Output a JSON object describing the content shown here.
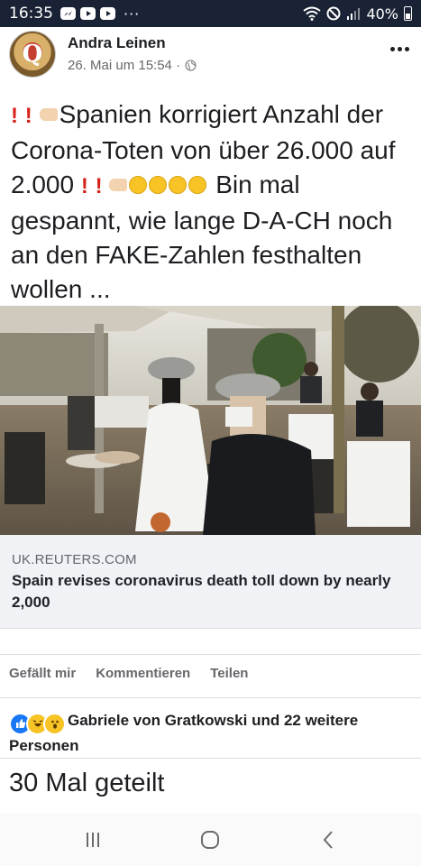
{
  "status_bar": {
    "time": "16:35",
    "dots": "···",
    "battery": "40%",
    "icons": [
      "messenger-icon",
      "youtube-icon",
      "youtube-icon",
      "wifi-icon",
      "do-not-disturb-icon",
      "signal-icon",
      "battery-icon"
    ]
  },
  "post": {
    "author": "Andra Leinen",
    "date": "26. Mai um 15:54 ·",
    "text_line1": "Spanien korrigiert Anzahl der Corona-Toten von über 26.000 auf 2.000",
    "text_line2": "Bin mal gespannt, wie lange D-A-CH noch an den FAKE-Zahlen festhalten wollen ...",
    "emoji_bang": "!"
  },
  "link_preview": {
    "domain": "UK.REUTERS.COM",
    "title": "Spain revises coronavirus death toll down by nearly 2,000"
  },
  "actions": {
    "like": "Gefällt mir",
    "comment": "Kommentieren",
    "share": "Teilen"
  },
  "reactions": {
    "text": "Gabriele von Gratkowski und 22 weitere Personen"
  },
  "shares": {
    "text": "30 Mal geteilt"
  },
  "colors": {
    "status_bar": "#1a2235",
    "link_box": "#f0f2f5",
    "like_blue": "#1877f2",
    "emoji_yellow": "#f7c325"
  }
}
